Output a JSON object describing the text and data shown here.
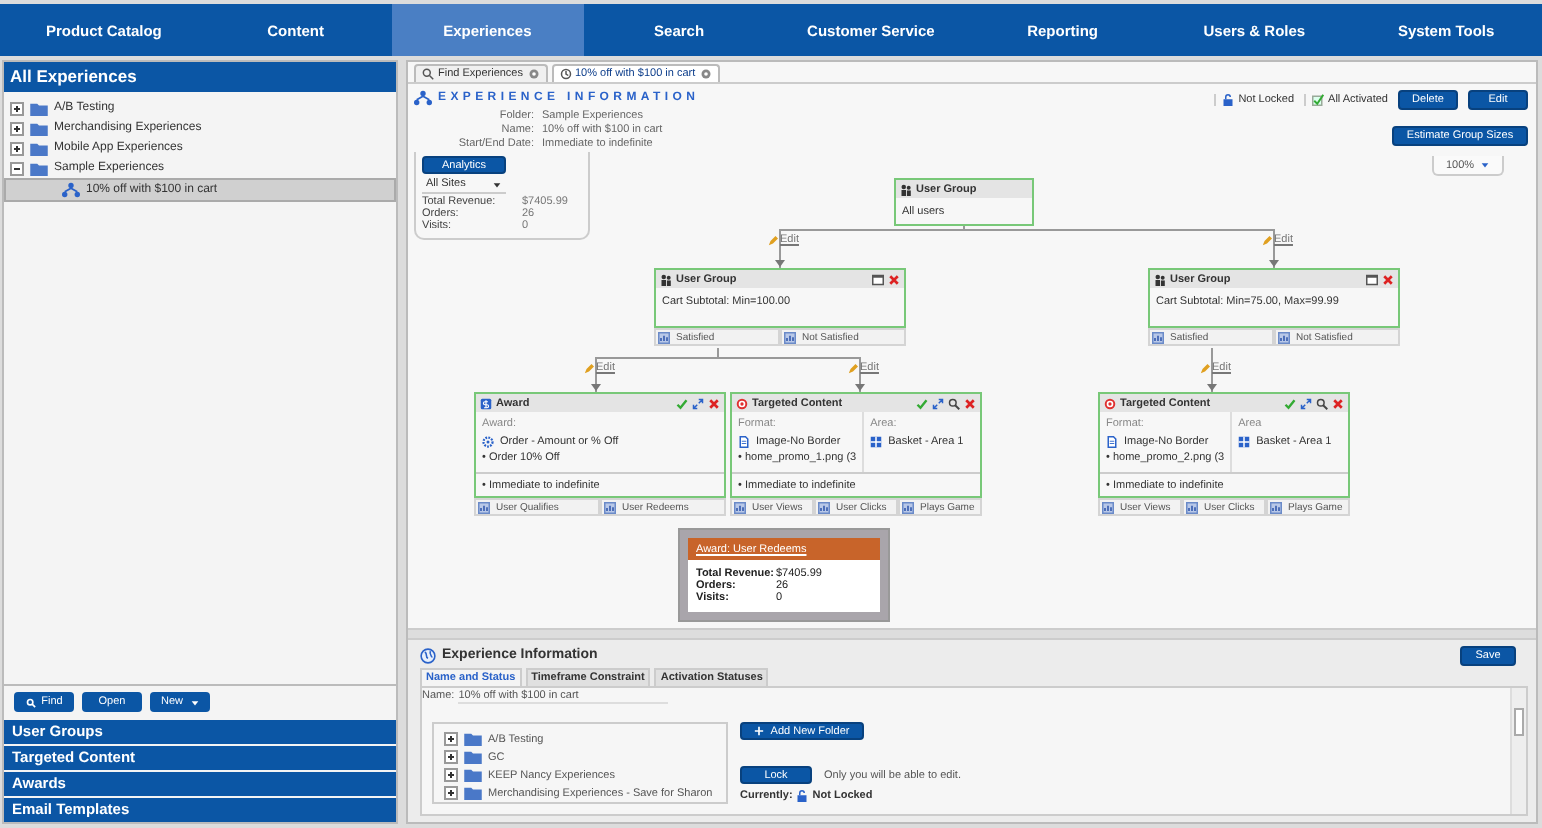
{
  "nav": [
    {
      "label": "Product Catalog",
      "selected": false
    },
    {
      "label": "Content",
      "selected": false
    },
    {
      "label": "Experiences",
      "selected": true
    },
    {
      "label": "Search",
      "selected": false
    },
    {
      "label": "Customer Service",
      "selected": false
    },
    {
      "label": "Reporting",
      "selected": false
    },
    {
      "label": "Users & Roles",
      "selected": false
    },
    {
      "label": "System Tools",
      "selected": false
    }
  ],
  "sidebar": {
    "title": "All Experiences",
    "tree": [
      {
        "label": "A/B Testing",
        "expanded": false,
        "selected": false
      },
      {
        "label": "Merchandising Experiences",
        "expanded": false,
        "selected": false
      },
      {
        "label": "Mobile App Experiences",
        "expanded": false,
        "selected": false
      },
      {
        "label": "Sample Experiences",
        "expanded": true,
        "selected": false,
        "children": [
          {
            "label": "10% off with $100 in cart",
            "selected": true
          }
        ]
      }
    ],
    "buttons": [
      {
        "label": "Find",
        "kind": "search"
      },
      {
        "label": "Open",
        "kind": "plain"
      },
      {
        "label": "New",
        "kind": "menu"
      }
    ],
    "sections": [
      "User Groups",
      "Targeted Content",
      "Awards",
      "Email Templates"
    ]
  },
  "tabs": [
    {
      "label": "Find Experiences",
      "kind": "search",
      "selected": false
    },
    {
      "label": "10% off with $100 in cart",
      "kind": "experience",
      "selected": true
    }
  ],
  "experience_info": {
    "heading": "EXPERIENCE INFORMATION",
    "fields": [
      {
        "label": "Folder:",
        "value": "Sample Experiences"
      },
      {
        "label": "Name:",
        "value": "10% off with $100 in cart"
      },
      {
        "label": "Start/End Date:",
        "value": "Immediate to indefinite"
      }
    ],
    "analytics_button": "Analytics",
    "site": "All Sites",
    "stats": [
      {
        "label": "Total Revenue:",
        "value": "$7405.99"
      },
      {
        "label": "Orders:",
        "value": "26"
      },
      {
        "label": "Visits:",
        "value": "0"
      }
    ]
  },
  "toolbar": {
    "statuses": [
      {
        "kind": "lock",
        "label": "Not Locked"
      },
      {
        "kind": "activated",
        "label": "All Activated"
      }
    ],
    "buttons": [
      "Delete",
      "Edit"
    ],
    "estimate_button": "Estimate Group Sizes",
    "zoom": "100%"
  },
  "diagram": {
    "nodes": [
      {
        "kind": "user_group",
        "title": "User Group",
        "body": "All users"
      },
      {
        "kind": "user_group",
        "title": "User Group",
        "body": "Cart Subtotal: Min=100.00",
        "outputs": [
          "Satisfied",
          "Not Satisfied"
        ]
      },
      {
        "kind": "user_group",
        "title": "User Group",
        "body": "Cart Subtotal: Min=75.00, Max=99.99",
        "outputs": [
          "Satisfied",
          "Not Satisfied"
        ]
      },
      {
        "kind": "award",
        "title": "Award",
        "label": "Award:",
        "item": "Order - Amount or % Off",
        "bullet": "• Order 10% Off",
        "schedule": "• Immediate to indefinite",
        "outputs": [
          "User Qualifies",
          "User Redeems"
        ]
      },
      {
        "kind": "targeted_content",
        "title": "Targeted Content",
        "format_label": "Format:",
        "format": "Image-No Border",
        "area_label": "Area:",
        "area": "Basket - Area 1",
        "bullet": "• home_promo_1.png (3",
        "schedule": "• Immediate to indefinite",
        "outputs": [
          "User Views",
          "User Clicks",
          "Plays Game"
        ]
      },
      {
        "kind": "targeted_content",
        "title": "Targeted Content",
        "format_label": "Format:",
        "format": "Image-No Border",
        "area_label": "Area",
        "area": "Basket - Area 1",
        "bullet": "• home_promo_2.png (3",
        "schedule": "• Immediate to indefinite",
        "outputs": [
          "User Views",
          "User Clicks",
          "Plays Game"
        ]
      }
    ],
    "edit_links": [
      "Edit",
      "Edit",
      "Edit",
      "Edit",
      "Edit"
    ],
    "tooltip": {
      "link": "Award: User Redeems",
      "rows": [
        {
          "label": "Total Revenue:",
          "value": "$7405.99"
        },
        {
          "label": "Orders:",
          "value": "26"
        },
        {
          "label": "Visits:",
          "value": "0"
        }
      ]
    }
  },
  "details": {
    "title": "Experience Information",
    "save_button": "Save",
    "tabs": [
      {
        "label": "Name and Status",
        "selected": true
      },
      {
        "label": "Timeframe Constraint",
        "selected": false
      },
      {
        "label": "Activation Statuses",
        "selected": false
      }
    ],
    "name_label": "Name:",
    "name_value": "10% off with $100 in cart",
    "folders": [
      {
        "label": "A/B Testing",
        "expanded": false
      },
      {
        "label": "GC",
        "expanded": false
      },
      {
        "label": "KEEP Nancy Experiences",
        "expanded": false
      },
      {
        "label": "Merchandising Experiences - Save for Sharon",
        "expanded": false
      }
    ],
    "add_folder_button": "Add New Folder",
    "lock_button": "Lock",
    "lock_note": "Only you will be able to edit.",
    "current_label": "Currently:",
    "current_value": "Not Locked"
  }
}
